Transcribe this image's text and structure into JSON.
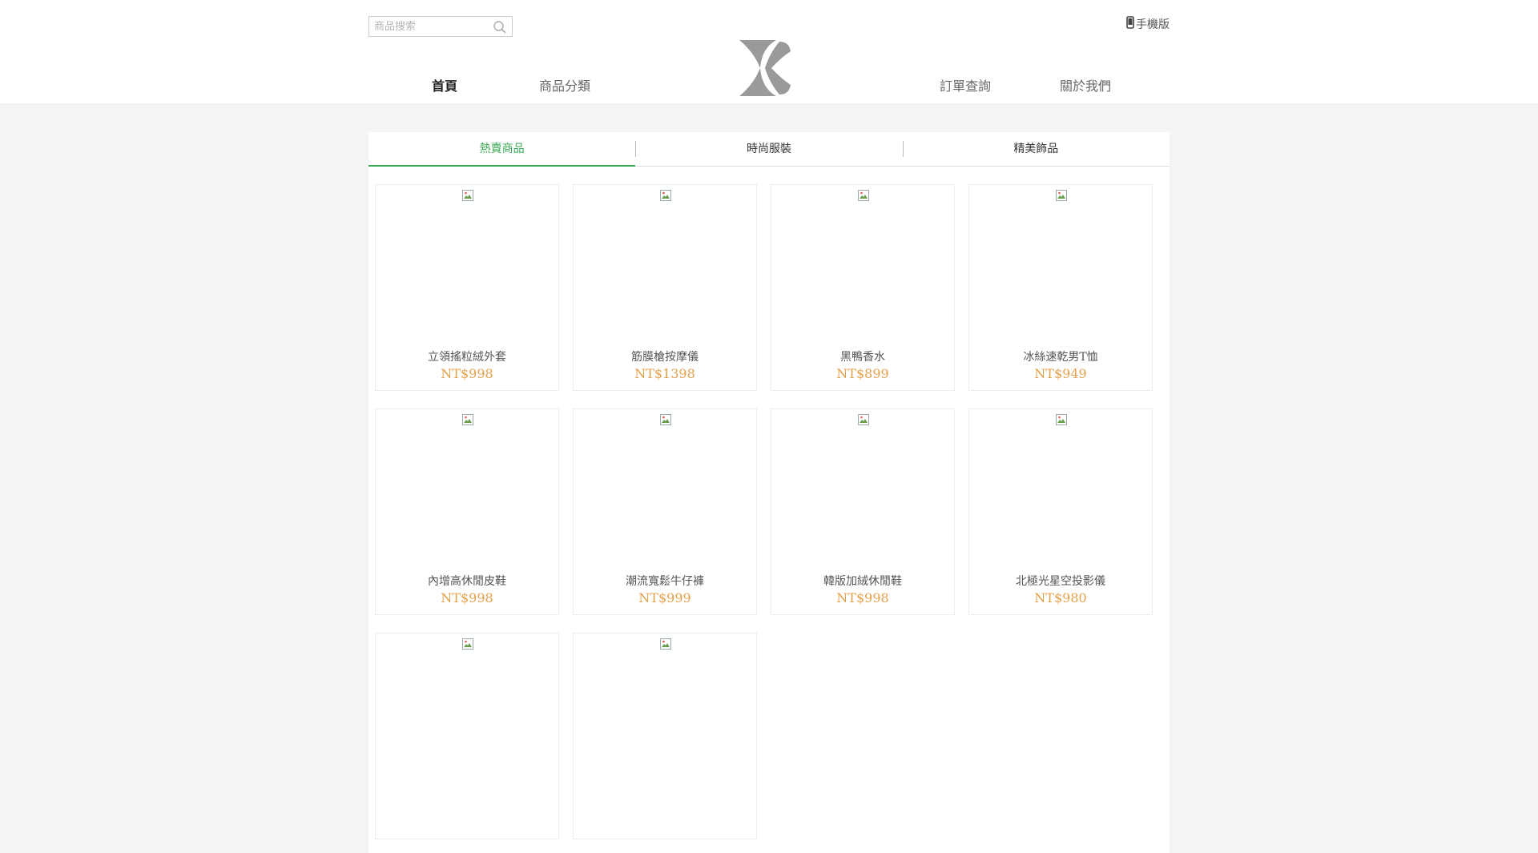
{
  "header": {
    "search_placeholder": "商品搜索",
    "mobile_label": "手機版",
    "nav": [
      {
        "label": "首頁"
      },
      {
        "label": "商品分類"
      },
      {
        "label": "訂單查詢"
      },
      {
        "label": "關於我們"
      }
    ]
  },
  "tabs": [
    {
      "label": "熱賣商品"
    },
    {
      "label": "時尚服裝"
    },
    {
      "label": "精美飾品"
    }
  ],
  "products": [
    {
      "name": "立領搖粒絨外套",
      "price": "NT$998"
    },
    {
      "name": "筋膜槍按摩儀",
      "price": "NT$1398"
    },
    {
      "name": "黑鴨香水",
      "price": "NT$899"
    },
    {
      "name": "冰絲速乾男T恤",
      "price": "NT$949"
    },
    {
      "name": "內增高休閒皮鞋",
      "price": "NT$998"
    },
    {
      "name": "潮流寬鬆牛仔褲",
      "price": "NT$999"
    },
    {
      "name": "韓版加絨休閒鞋",
      "price": "NT$998"
    },
    {
      "name": "北極光星空投影儀",
      "price": "NT$980"
    },
    {
      "name": "",
      "price": ""
    },
    {
      "name": "",
      "price": ""
    }
  ],
  "colors": {
    "accent": "#3aaa52",
    "price": "#e4a04a",
    "logo": "#9a9a9a"
  },
  "icons": {
    "search": "search-icon",
    "mobile": "mobile-phone-icon",
    "logo": "brand-logo",
    "broken_image": "broken-image-icon"
  }
}
